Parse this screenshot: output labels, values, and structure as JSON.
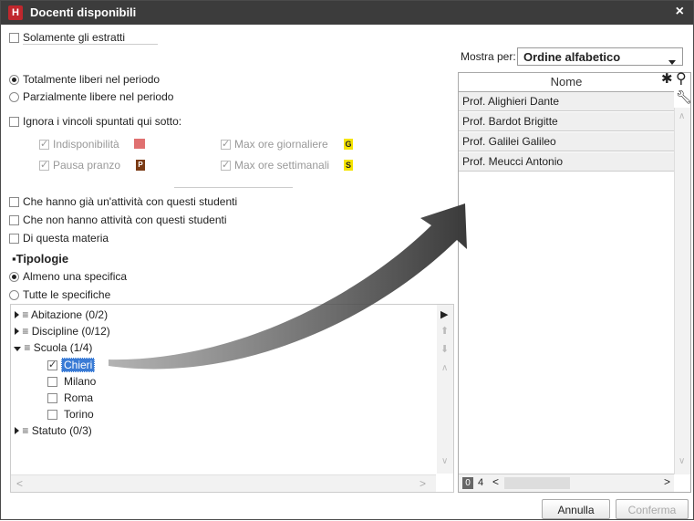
{
  "window": {
    "app_icon": "H",
    "title": "Docenti disponibili",
    "close": "×"
  },
  "left": {
    "solo_estratti": "Solamente gli estratti",
    "totalmente": "Totalmente liberi nel periodo",
    "parzialmente": "Parzialmente libere nel periodo",
    "ignora": "Ignora i vincoli spuntati qui sotto:",
    "indisponibilita": "Indisponibilità",
    "max_giornaliere": "Max ore giornaliere",
    "max_giornaliere_badge": "G",
    "pausa": "Pausa pranzo",
    "pausa_badge": "P",
    "max_settimanali": "Max ore settimanali",
    "max_settimanali_badge": "S",
    "gia_attivita": "Che hanno già un'attività con questi studenti",
    "non_attivita": "Che non hanno attività con questi studenti",
    "materia": "Di questa materia",
    "tipologie": "Tipologie",
    "almeno": "Almeno una specifica",
    "tutte": "Tutte le specifiche"
  },
  "tree": {
    "items": [
      {
        "label": "Abitazione (0/2)"
      },
      {
        "label": "Discipline (0/12)"
      },
      {
        "label": "Scuola (1/4)"
      },
      {
        "label": "Chieri"
      },
      {
        "label": "Milano"
      },
      {
        "label": "Roma"
      },
      {
        "label": "Torino"
      },
      {
        "label": "Statuto (0/3)"
      }
    ]
  },
  "right": {
    "mostra_label": "Mostra per:",
    "mostra_value": "Ordine alfabetico",
    "column": "Nome",
    "rows": [
      "Prof. Alighieri Dante",
      "Prof. Bardot Brigitte",
      "Prof. Galilei Galileo",
      "Prof. Meucci Antonio"
    ],
    "count_a": "0",
    "count_b": "4"
  },
  "buttons": {
    "annulla": "Annulla",
    "conferma": "Conferma"
  },
  "colors": {
    "titlebar": "#3c3c3c",
    "brand": "#c0272d",
    "selected": "#3a7bd5",
    "arrow": "#555555"
  }
}
